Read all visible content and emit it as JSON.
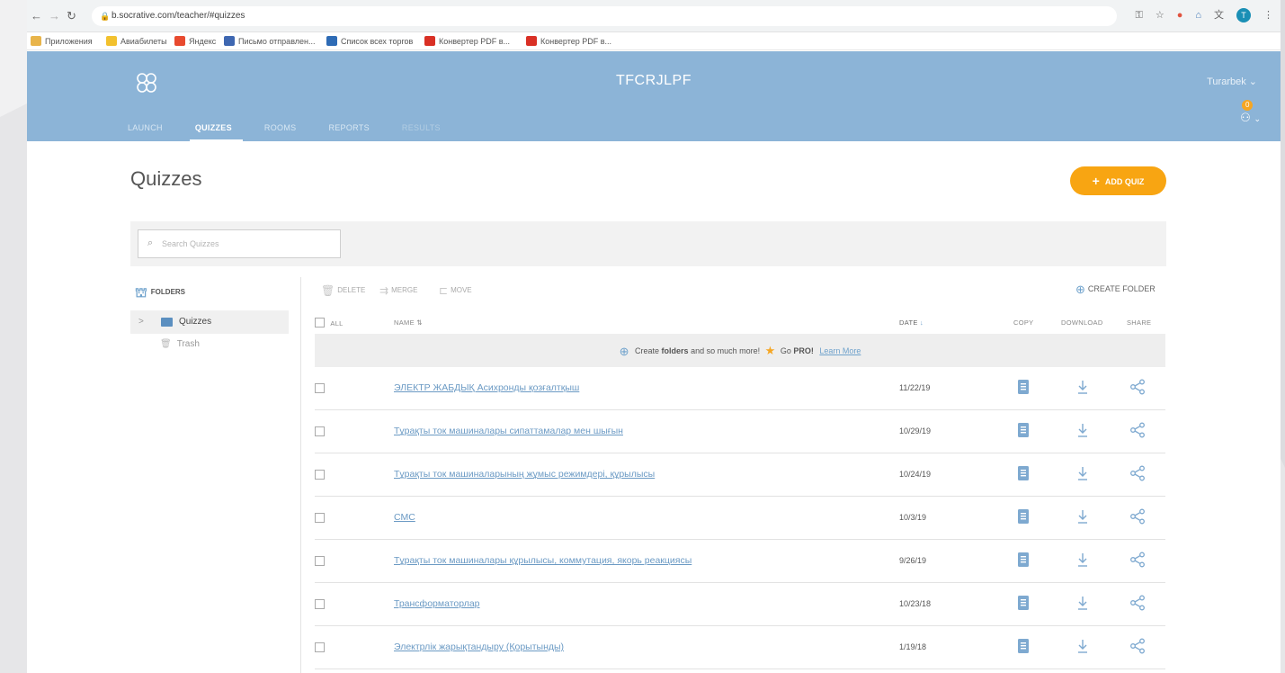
{
  "browser": {
    "url": "b.socrative.com/teacher/#quizzes",
    "bookmarks": [
      {
        "label": "Приложения",
        "color": "#e8b44a"
      },
      {
        "label": "Авиабилеты",
        "color": "#f2c12e"
      },
      {
        "label": "Яндекс",
        "color": "#e84a2f"
      },
      {
        "label": "Письмо отправлен...",
        "color": "#3e67b1"
      },
      {
        "label": "Список всех торгов",
        "color": "#2e6bb5"
      },
      {
        "label": "Конвертер PDF в...",
        "color": "#d93025"
      },
      {
        "label": "Конвертер PDF в...",
        "color": "#d93025"
      }
    ],
    "avatar_letter": "T"
  },
  "header": {
    "room_name": "TFCRJLPF",
    "user_name": "Turarbek ⌄",
    "tabs": [
      {
        "label": "LAUNCH"
      },
      {
        "label": "QUIZZES"
      },
      {
        "label": "ROOMS"
      },
      {
        "label": "REPORTS"
      },
      {
        "label": "RESULTS"
      }
    ],
    "notification_count": "0",
    "accent": "#8cb4d7"
  },
  "page": {
    "title": "Quizzes",
    "add_quiz_label": "ADD QUIZ",
    "search_placeholder": "Search Quizzes"
  },
  "folders": {
    "heading": "FOLDERS",
    "items": [
      {
        "label": "Quizzes"
      },
      {
        "label": "Trash"
      }
    ]
  },
  "toolbar": {
    "delete": "DELETE",
    "merge": "MERGE",
    "move": "MOVE",
    "create_folder": "CREATE FOLDER"
  },
  "table": {
    "headers": {
      "all": "ALL",
      "name": "NAME",
      "date": "DATE",
      "copy": "COPY",
      "download": "DOWNLOAD",
      "share": "SHARE"
    },
    "promo": {
      "text_before": "Create",
      "text_bold": "folders",
      "text_after": "and so much more!",
      "go": "Go",
      "pro": "PRO!",
      "link": "Learn More"
    },
    "rows": [
      {
        "name": "ЭЛЕКТР ЖАБДЫҚ Асихронды қозғалтқыш",
        "date": "11/22/19"
      },
      {
        "name": "Тұрақты ток машиналары сипаттамалар мен шығын",
        "date": "10/29/19"
      },
      {
        "name": "Тұрақты ток машиналарының жұмыс режимдері, құрылысы",
        "date": "10/24/19"
      },
      {
        "name": "СМС",
        "date": "10/3/19"
      },
      {
        "name": "Тұрақты ток машиналары құрылысы, коммутация, якорь реакциясы",
        "date": "9/26/19"
      },
      {
        "name": "Трансформаторлар",
        "date": "10/23/18"
      },
      {
        "name": "Электрлік жарықтандыру (Қорытынды)",
        "date": "1/19/18"
      }
    ]
  }
}
